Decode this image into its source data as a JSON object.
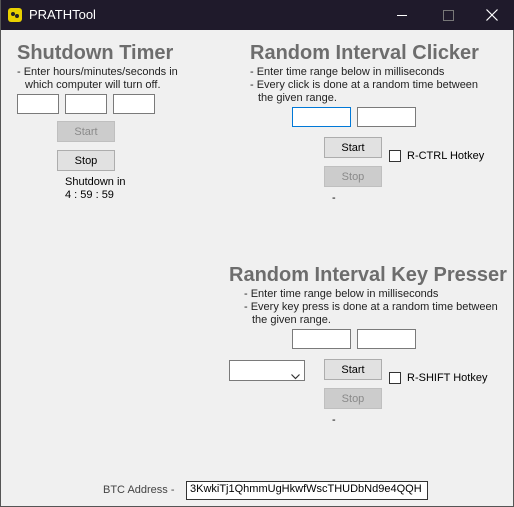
{
  "window": {
    "title": "PRATHTool"
  },
  "shutdown": {
    "heading": "Shutdown Timer",
    "desc_line1": "- Enter hours/minutes/seconds in",
    "desc_line2": "which computer will turn off.",
    "hours_value": "",
    "minutes_value": "",
    "seconds_value": "",
    "start_label": "Start",
    "stop_label": "Stop",
    "status_line1": "Shutdown in",
    "status_line2": "4 : 59 : 59"
  },
  "clicker": {
    "heading": "Random Interval Clicker",
    "desc_line1": "- Enter time range below in milliseconds",
    "desc_line2": "- Every click is done at a random time between",
    "desc_line3": "the given range.",
    "min_value": "",
    "max_value": "",
    "start_label": "Start",
    "stop_label": "Stop",
    "hotkey_label": "R-CTRL Hotkey",
    "hotkey_checked": false,
    "status": "-"
  },
  "presser": {
    "heading": "Random Interval Key Presser",
    "desc_line1": "- Enter time range below in milliseconds",
    "desc_line2": "- Every key press is done at a random time between",
    "desc_line3": "the given range.",
    "min_value": "",
    "max_value": "",
    "key_selected": "",
    "start_label": "Start",
    "stop_label": "Stop",
    "hotkey_label": "R-SHIFT Hotkey",
    "hotkey_checked": false,
    "status": "-"
  },
  "footer": {
    "btc_label": "BTC Address -",
    "btc_address": "3KwkiTj1QhmmUgHkwfWscTHUDbNd9e4QQH"
  },
  "icons": {
    "app": "app-icon",
    "minimize": "minimize-icon",
    "maximize": "maximize-icon",
    "close": "close-icon",
    "dropdown": "chevron-down-icon"
  }
}
